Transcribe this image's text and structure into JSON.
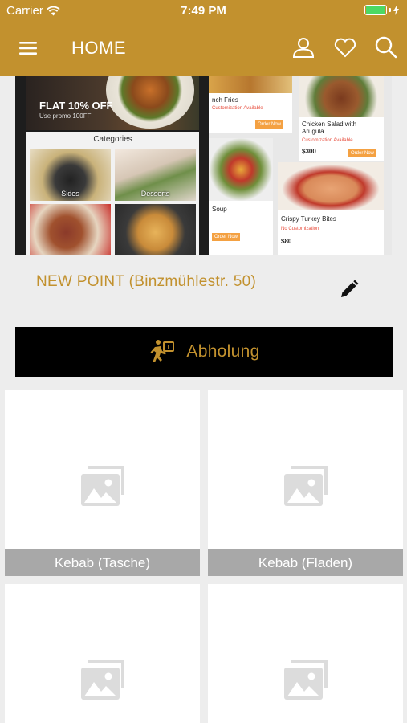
{
  "status_bar": {
    "carrier": "Carrier",
    "time": "7:49 PM",
    "battery_level": 1.0
  },
  "nav": {
    "title": "HOME",
    "icons": [
      "hamburger-menu-icon",
      "user-icon",
      "heart-icon",
      "search-icon"
    ]
  },
  "banner": {
    "promo_text": "FLAT 10% OFF",
    "promo_code": "Use promo 100FF",
    "categories_title": "Categories",
    "categories": [
      "Sides",
      "Desserts",
      "",
      ""
    ],
    "products": [
      {
        "name": "nch Fries",
        "tag": "Customization Available",
        "price": "",
        "button": "Order Now"
      },
      {
        "name": "Chicken Salad with Arugula",
        "tag": "Customization Available",
        "price": "$300",
        "button": "Order Now"
      },
      {
        "name": "Soup",
        "tag": "",
        "price": "",
        "button": "Order Now"
      },
      {
        "name": "Crispy Turkey Bites",
        "tag": "No Customization",
        "price": "$80",
        "button": ""
      }
    ]
  },
  "location": {
    "name": "NEW POINT (Binzmühlestr. 50)"
  },
  "pickup": {
    "label": "Abholung"
  },
  "menu_categories": [
    {
      "label": "Kebab (Tasche)"
    },
    {
      "label": "Kebab (Fladen)"
    },
    {
      "label": ""
    },
    {
      "label": ""
    }
  ],
  "colors": {
    "brand": "#c2912e",
    "caption_bg": "#a8a8a8",
    "pickup_bg": "#000000",
    "page_bg": "#ededed"
  }
}
